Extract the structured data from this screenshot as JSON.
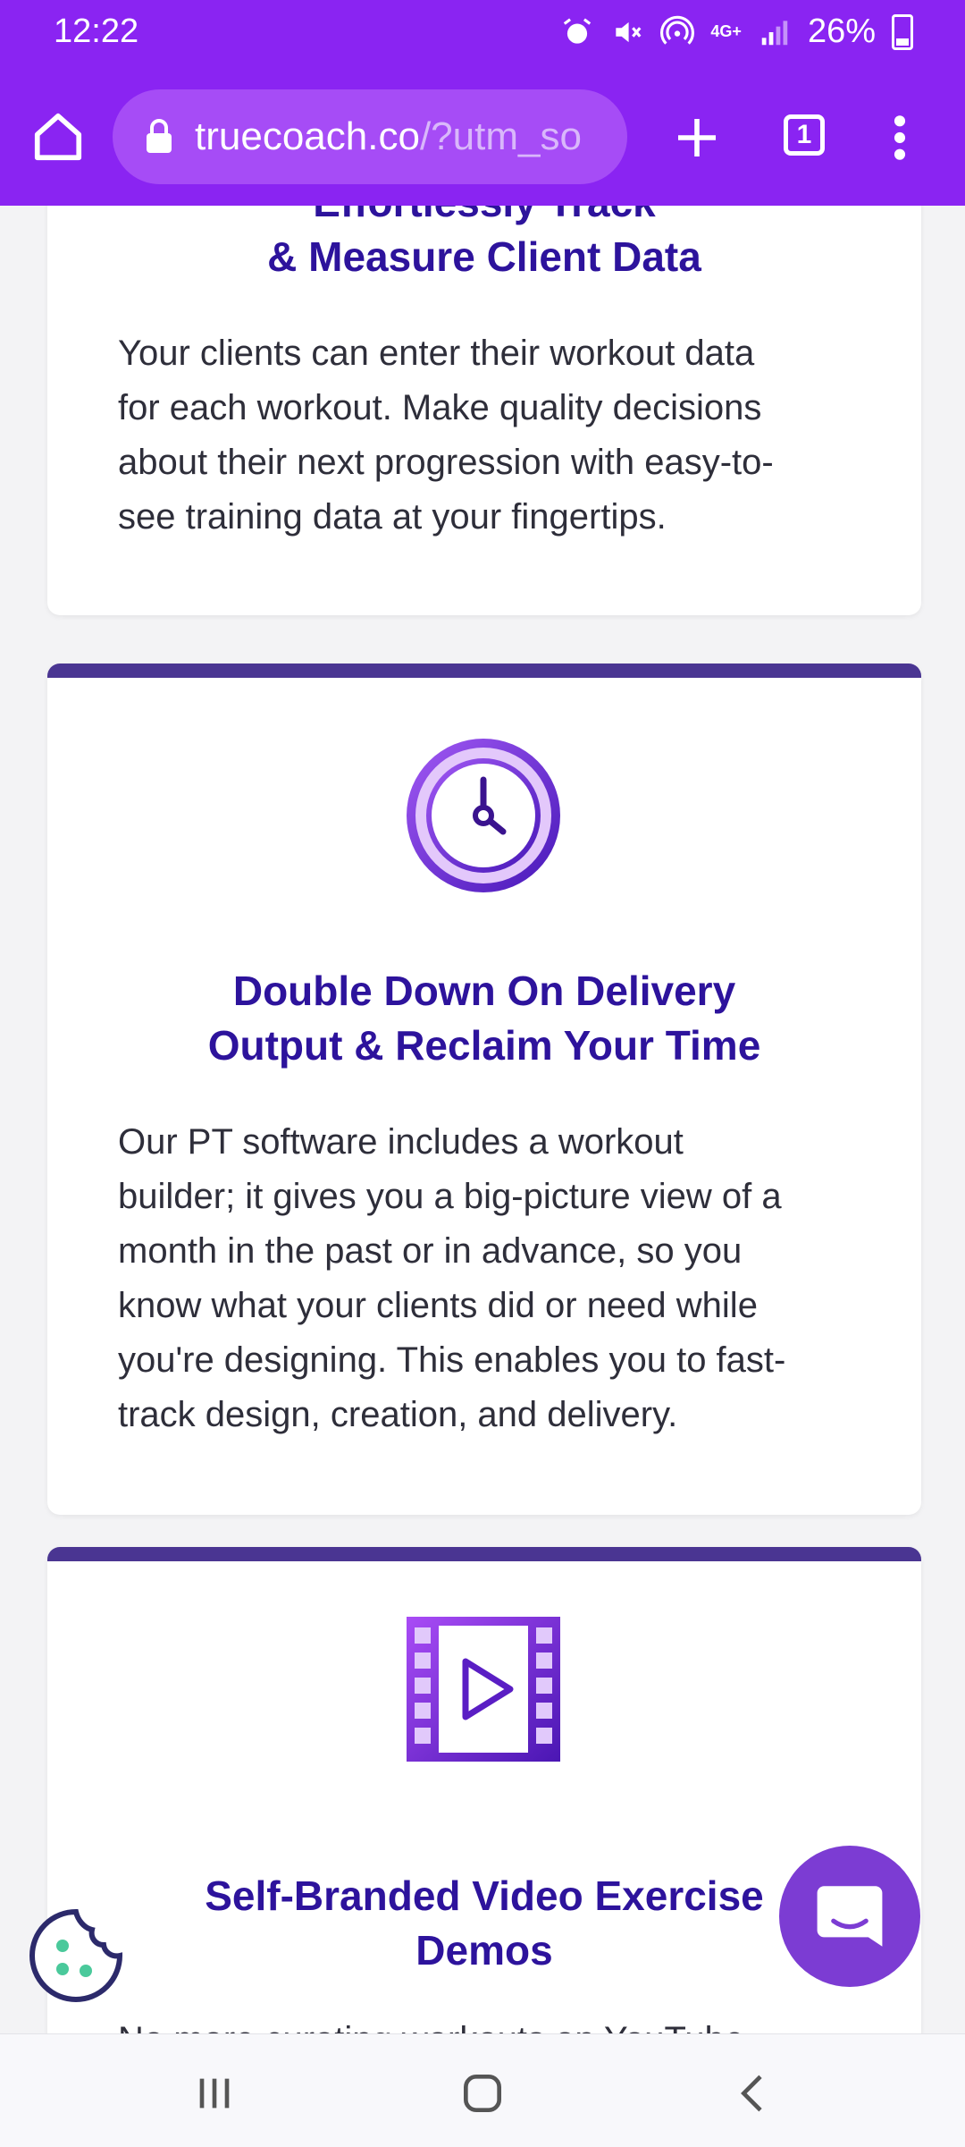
{
  "status_bar": {
    "time": "12:22",
    "network": "4G+",
    "battery": "26%"
  },
  "browser": {
    "url_host": "truecoach.co",
    "url_rest": "/?utm_so",
    "tab_count": "1"
  },
  "cards": [
    {
      "title_lines": [
        "Effortlessly Track",
        "& Measure Client Data"
      ],
      "body_lines": [
        "Your clients can enter their workout data",
        "for each workout. Make quality decisions",
        "about their next progression with easy-to-",
        "see training data at your fingertips."
      ]
    },
    {
      "icon": "clock-icon",
      "title_lines": [
        "Double Down On Delivery",
        "Output & Reclaim Your Time"
      ],
      "body_lines": [
        "Our PT software includes a workout",
        "builder; it gives you a big-picture view of a",
        "month in the past or in advance, so you",
        "know what your clients did or need while",
        "you're designing. This enables you to fast-",
        "track design, creation, and delivery."
      ]
    },
    {
      "icon": "video-play-icon",
      "title_lines": [
        "Self-Branded Video Exercise",
        "Demos"
      ],
      "body_lines": [
        "No more curating workouts on YouTube"
      ]
    }
  ],
  "colors": {
    "toolbar": "#8a24f2",
    "title": "#2d139c",
    "accent_bar": "#4a3592",
    "chat_button": "#7c3cd3"
  }
}
